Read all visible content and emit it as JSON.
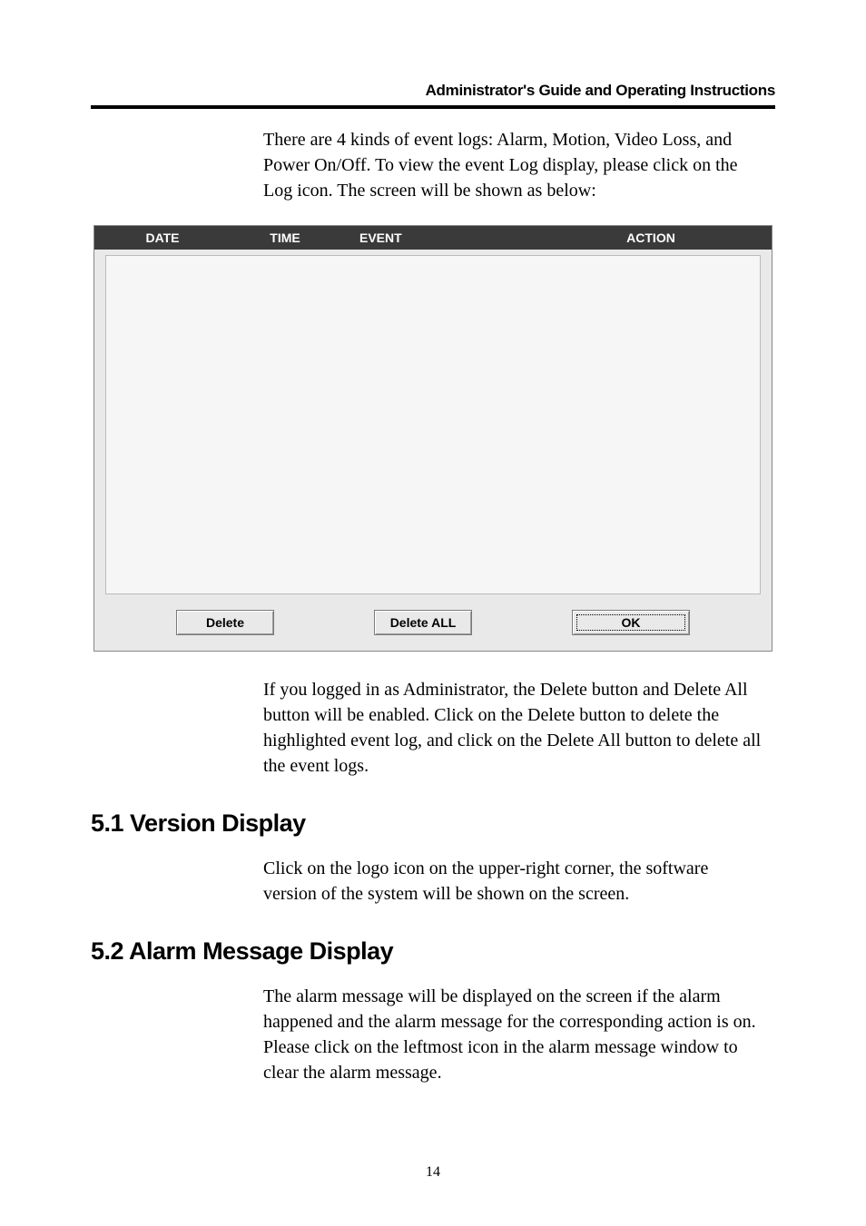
{
  "header": {
    "title": "Administrator's Guide and Operating Instructions"
  },
  "intro_text": "There are 4 kinds of event logs: Alarm, Motion, Video Loss, and Power On/Off.   To view the event Log display, please click on the Log icon.   The screen will be shown as below:",
  "dialog": {
    "columns": {
      "date": "DATE",
      "time": "TIME",
      "event": "EVENT",
      "action": "ACTION"
    },
    "buttons": {
      "delete": "Delete",
      "delete_all": "Delete ALL",
      "ok": "OK"
    }
  },
  "post_dialog_text": "If you logged in as Administrator, the Delete button and Delete All button will be enabled.   Click on the Delete button to delete the highlighted event log, and click on the Delete All button to delete all the event logs.",
  "section_51": {
    "heading": "5.1 Version Display",
    "body": "Click on the logo icon on the upper-right corner, the software version of the system will be shown on the screen."
  },
  "section_52": {
    "heading": "5.2 Alarm Message Display",
    "body": "The alarm message will be displayed on the screen if the alarm happened and the alarm message for the corresponding action is on.   Please click on the leftmost icon in the alarm message window to clear the alarm message."
  },
  "page_number": "14"
}
